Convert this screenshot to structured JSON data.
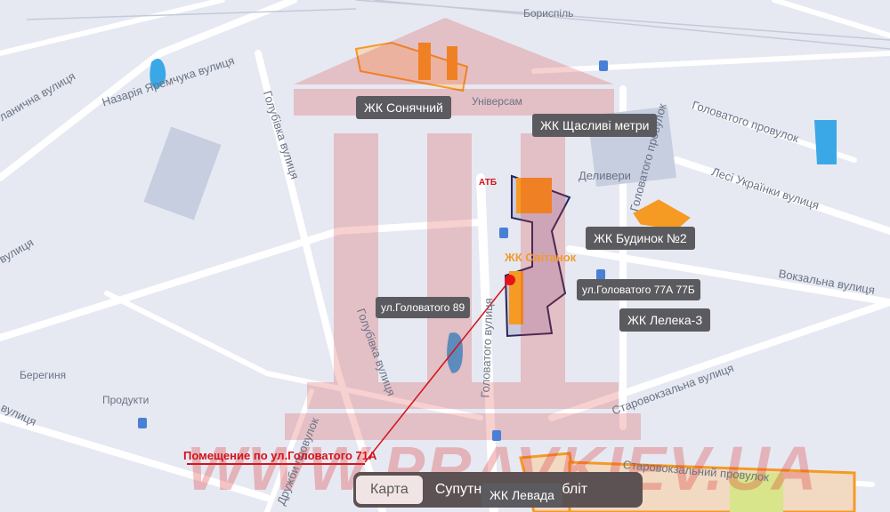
{
  "streets": {
    "nazariia": "Назарія Яремчука вулиця",
    "holubivka_top": "Голубівка вулиця",
    "holubivka_bottom": "Голубівка вулиця",
    "holovatoho": "Головатого вулиця",
    "holovatoho_lane_v": "Головатого провулок",
    "holovatoho_lane": "Головатого провулок",
    "lesi": "Лесі Українки вулиця",
    "vokzalna": "Вокзальна вулиця",
    "starovokzalna": "Старовокзальна вулиця",
    "starovokzalnyi_lane": "Старовокзальний провулок",
    "druzhby_lane": "Дружби провулок",
    "left_street1": "ланична вулиця",
    "left_street2": "вулиця",
    "left_street3": "вулиця"
  },
  "pois": {
    "boryspil": "Бориспіль",
    "universam": "Універсам",
    "atb": "АТБ",
    "deliveri": "Деливери",
    "berehynia": "Берегиня",
    "produkty": "Продукти"
  },
  "complexes": {
    "sonyachnyi": "ЖК Сонячний",
    "shchaslivi": "ЖК Щасливі метри",
    "budynok2": "ЖК Будинок №2",
    "svitanok": "ЖК Світанок",
    "address_89": "ул.Головатого 89",
    "address_77": "ул.Головатого 77А 77Б",
    "leleka": "ЖК Лелека-3",
    "levada": "ЖК Левада"
  },
  "callout": "Помещение по ул.Головатого 71А",
  "map_type": {
    "map": "Карта",
    "satellite": "Супутник",
    "aerial": "Аерообліт",
    "active": "map"
  },
  "watermark": "WWW.PRAVKIEV.UA",
  "colors": {
    "building": "#f59a23",
    "marker": "#e8121b",
    "boundary": "#27285a",
    "tag_bg": "#5b5b5f"
  }
}
